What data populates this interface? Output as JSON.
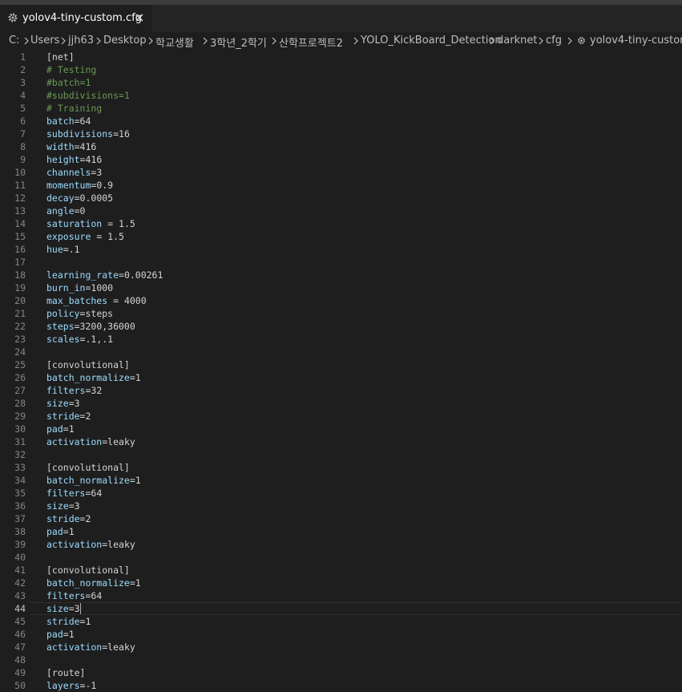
{
  "tab": {
    "title": "yolov4-tiny-custom.cfg",
    "icon": "gear-icon",
    "close_icon": "close-icon"
  },
  "breadcrumb": [
    "C:",
    "Users",
    "jjh63",
    "Desktop",
    "학교생활",
    "3학년_2학기",
    "산학프로젝트2",
    "YOLO_KickBoard_Detection",
    "darknet",
    "cfg",
    "yolov4-tiny-custom.cfg"
  ],
  "active_line": 44,
  "lines": [
    {
      "n": "1",
      "key": "",
      "val": "[net]",
      "type": "plain"
    },
    {
      "n": "2",
      "key": "",
      "val": "# Testing",
      "type": "comment"
    },
    {
      "n": "3",
      "key": "",
      "val": "#batch=1",
      "type": "comment"
    },
    {
      "n": "4",
      "key": "",
      "val": "#subdivisions=1",
      "type": "comment"
    },
    {
      "n": "5",
      "key": "",
      "val": "# Training",
      "type": "comment"
    },
    {
      "n": "6",
      "key": "batch",
      "val": "=64",
      "type": "kv"
    },
    {
      "n": "7",
      "key": "subdivisions",
      "val": "=16",
      "type": "kv"
    },
    {
      "n": "8",
      "key": "width",
      "val": "=416",
      "type": "kv"
    },
    {
      "n": "9",
      "key": "height",
      "val": "=416",
      "type": "kv"
    },
    {
      "n": "10",
      "key": "channels",
      "val": "=3",
      "type": "kv"
    },
    {
      "n": "11",
      "key": "momentum",
      "val": "=0.9",
      "type": "kv"
    },
    {
      "n": "12",
      "key": "decay",
      "val": "=0.0005",
      "type": "kv"
    },
    {
      "n": "13",
      "key": "angle",
      "val": "=0",
      "type": "kv"
    },
    {
      "n": "14",
      "key": "saturation",
      "val": " = 1.5",
      "type": "kv"
    },
    {
      "n": "15",
      "key": "exposure",
      "val": " = 1.5",
      "type": "kv"
    },
    {
      "n": "16",
      "key": "hue",
      "val": "=.1",
      "type": "kv"
    },
    {
      "n": "17",
      "key": "",
      "val": "",
      "type": "plain"
    },
    {
      "n": "18",
      "key": "learning_rate",
      "val": "=0.00261",
      "type": "kv"
    },
    {
      "n": "19",
      "key": "burn_in",
      "val": "=1000",
      "type": "kv"
    },
    {
      "n": "20",
      "key": "max_batches",
      "val": " = 4000",
      "type": "kv"
    },
    {
      "n": "21",
      "key": "policy",
      "val": "=steps",
      "type": "kv"
    },
    {
      "n": "22",
      "key": "steps",
      "val": "=3200,36000",
      "type": "kv"
    },
    {
      "n": "23",
      "key": "scales",
      "val": "=.1,.1",
      "type": "kv"
    },
    {
      "n": "24",
      "key": "",
      "val": "",
      "type": "plain"
    },
    {
      "n": "25",
      "key": "",
      "val": "[convolutional]",
      "type": "plain"
    },
    {
      "n": "26",
      "key": "batch_normalize",
      "val": "=1",
      "type": "kv"
    },
    {
      "n": "27",
      "key": "filters",
      "val": "=32",
      "type": "kv"
    },
    {
      "n": "28",
      "key": "size",
      "val": "=3",
      "type": "kv"
    },
    {
      "n": "29",
      "key": "stride",
      "val": "=2",
      "type": "kv"
    },
    {
      "n": "30",
      "key": "pad",
      "val": "=1",
      "type": "kv"
    },
    {
      "n": "31",
      "key": "activation",
      "val": "=leaky",
      "type": "kv"
    },
    {
      "n": "32",
      "key": "",
      "val": "",
      "type": "plain"
    },
    {
      "n": "33",
      "key": "",
      "val": "[convolutional]",
      "type": "plain"
    },
    {
      "n": "34",
      "key": "batch_normalize",
      "val": "=1",
      "type": "kv"
    },
    {
      "n": "35",
      "key": "filters",
      "val": "=64",
      "type": "kv"
    },
    {
      "n": "36",
      "key": "size",
      "val": "=3",
      "type": "kv"
    },
    {
      "n": "37",
      "key": "stride",
      "val": "=2",
      "type": "kv"
    },
    {
      "n": "38",
      "key": "pad",
      "val": "=1",
      "type": "kv"
    },
    {
      "n": "39",
      "key": "activation",
      "val": "=leaky",
      "type": "kv"
    },
    {
      "n": "40",
      "key": "",
      "val": "",
      "type": "plain"
    },
    {
      "n": "41",
      "key": "",
      "val": "[convolutional]",
      "type": "plain"
    },
    {
      "n": "42",
      "key": "batch_normalize",
      "val": "=1",
      "type": "kv"
    },
    {
      "n": "43",
      "key": "filters",
      "val": "=64",
      "type": "kv"
    },
    {
      "n": "44",
      "key": "size",
      "val": "=3",
      "type": "kv"
    },
    {
      "n": "45",
      "key": "stride",
      "val": "=1",
      "type": "kv"
    },
    {
      "n": "46",
      "key": "pad",
      "val": "=1",
      "type": "kv"
    },
    {
      "n": "47",
      "key": "activation",
      "val": "=leaky",
      "type": "kv"
    },
    {
      "n": "48",
      "key": "",
      "val": "",
      "type": "plain"
    },
    {
      "n": "49",
      "key": "",
      "val": "[route]",
      "type": "plain"
    },
    {
      "n": "50",
      "key": "layers",
      "val": "=-1",
      "type": "kv"
    }
  ],
  "colors": {
    "background": "#1e1e1e",
    "key": "#9cdcfe",
    "comment": "#6a9955",
    "text": "#d4d4d4",
    "line_number": "#858585"
  }
}
